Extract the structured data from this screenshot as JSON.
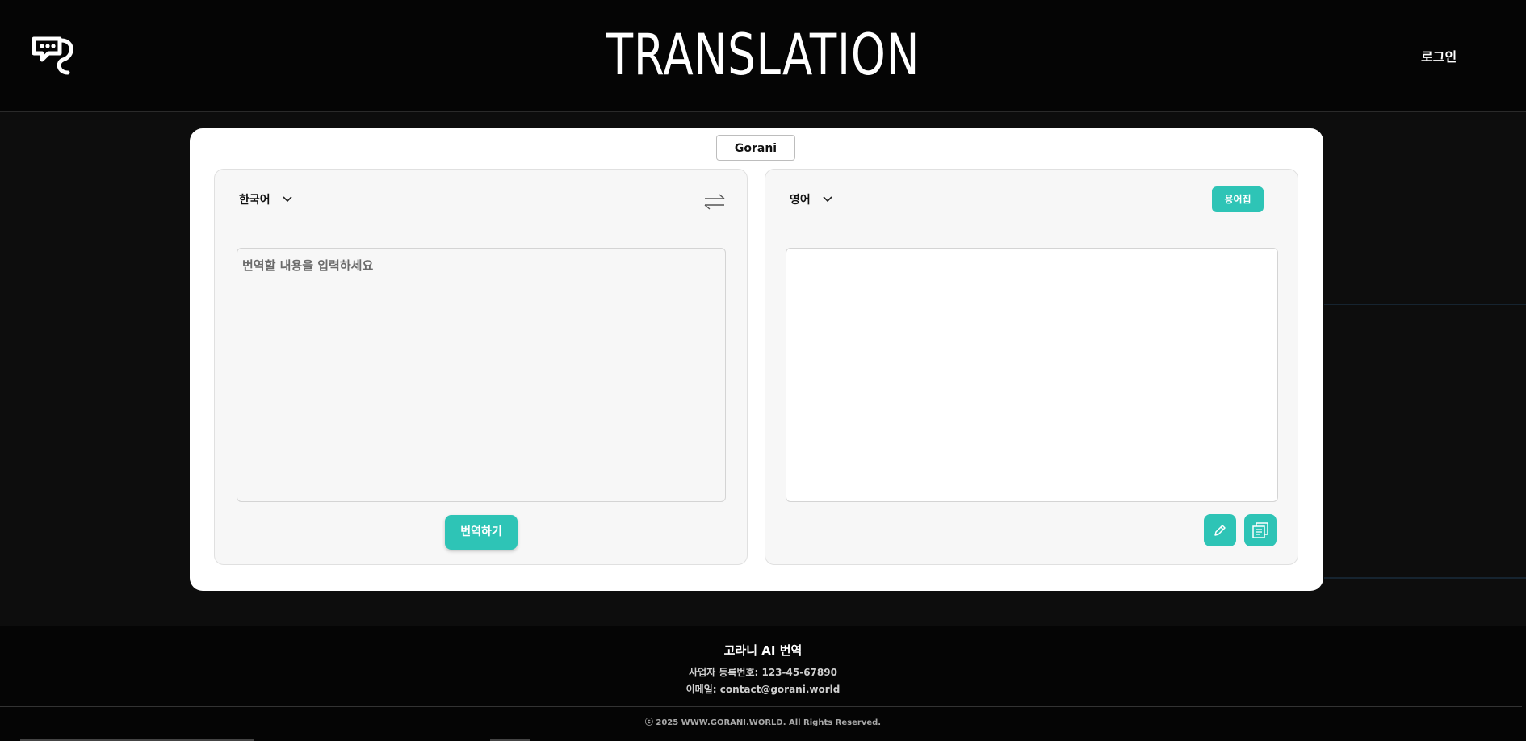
{
  "header": {
    "title": "TRANSLATION",
    "login_label": "로그인"
  },
  "model_tab": {
    "label": "Gorani"
  },
  "source_panel": {
    "language": "한국어",
    "placeholder": "번역할 내용을 입력하세요",
    "translate_label": "번역하기"
  },
  "target_panel": {
    "language": "영어",
    "glossary_label": "용어집"
  },
  "footer": {
    "title": "고라니 AI 번역",
    "business_number": "사업자 등록번호: 123-45-67890",
    "email": "이메일: contact@gorani.world",
    "copyright": "ⓒ 2025 WWW.GORANI.WORLD. All Rights Reserved."
  },
  "colors": {
    "accent": "#2ec4b6",
    "header_bg": "#050505",
    "page_bg": "#0d0d0d"
  },
  "icons": [
    "logo-icon",
    "chevron-down-icon",
    "swap-icon",
    "edit-icon",
    "copy-icon"
  ]
}
